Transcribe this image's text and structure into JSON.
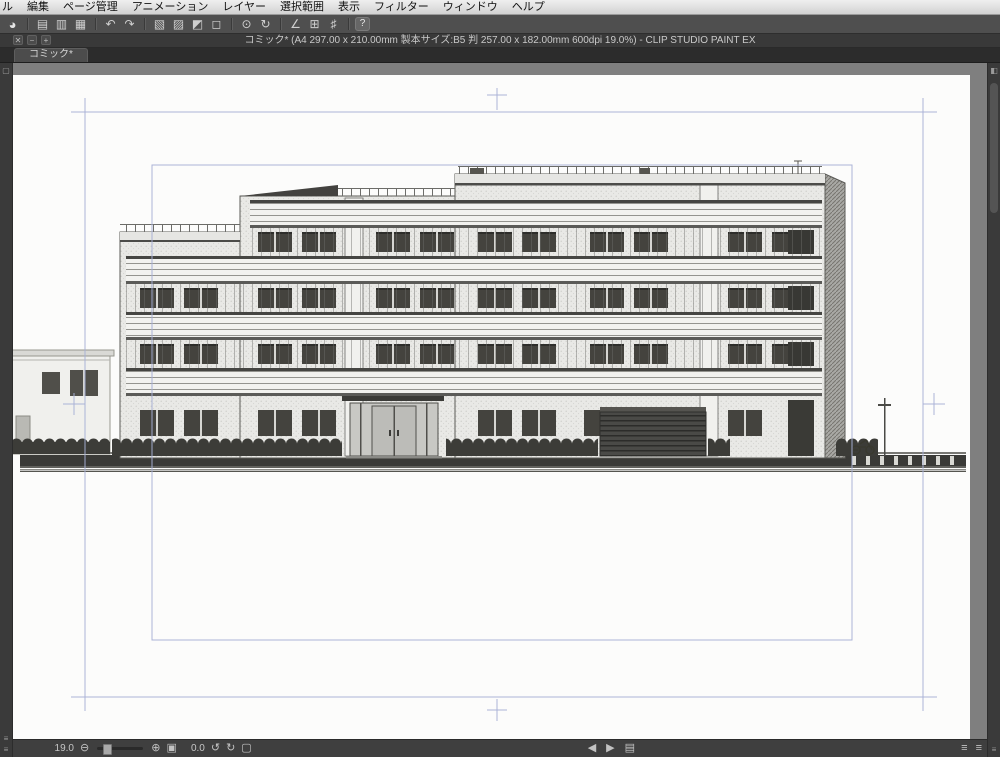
{
  "menubar": {
    "items": [
      "ル",
      "編集",
      "ページ管理",
      "アニメーション",
      "レイヤー",
      "選択範囲",
      "表示",
      "フィルター",
      "ウィンドウ",
      "ヘルプ"
    ]
  },
  "toolbar": {
    "icons": [
      {
        "name": "clip-studio-logo-icon",
        "glyph": "◕"
      },
      {
        "name": "new-canvas-icon",
        "glyph": "▤"
      },
      {
        "name": "open-file-icon",
        "glyph": "▥"
      },
      {
        "name": "save-icon",
        "glyph": "▦"
      },
      {
        "name": "undo-icon",
        "glyph": "↶"
      },
      {
        "name": "redo-icon",
        "glyph": "↷"
      },
      {
        "name": "deselect-icon",
        "glyph": "▧"
      },
      {
        "name": "reselect-icon",
        "glyph": "▨"
      },
      {
        "name": "invert-selection-icon",
        "glyph": "◩"
      },
      {
        "name": "marquee-icon",
        "glyph": "◻"
      },
      {
        "name": "zoom-tool-icon",
        "glyph": "⊙"
      },
      {
        "name": "rotate-canvas-icon",
        "glyph": "↻"
      },
      {
        "name": "snap-ruler-icon",
        "glyph": "∠"
      },
      {
        "name": "snap-grid-icon",
        "glyph": "⊞"
      },
      {
        "name": "snap-guide-icon",
        "glyph": "♯"
      },
      {
        "name": "help-icon",
        "glyph": "?"
      }
    ]
  },
  "titlebar": {
    "title": "コミック* (A4 297.00 x 210.00mm 製本サイズ:B5 判 257.00 x 182.00mm 600dpi 19.0%)  - CLIP STUDIO PAINT EX",
    "buttons": {
      "close": "✕",
      "minimize": "−",
      "maximize": "+"
    }
  },
  "tabs": {
    "active": "コミック*"
  },
  "statusbar": {
    "zoom_value": "19.0",
    "rotation_value": "0.0",
    "icons": {
      "zoom_out": "⊖",
      "zoom_in": "⊕",
      "fit": "▣",
      "rotate_left": "↺",
      "rotate_right": "↻",
      "reset": "▢",
      "prev_page": "◀",
      "next_page": "▶",
      "page_list": "▤",
      "panel_toggle_1": "≡",
      "panel_toggle_2": "≡"
    }
  },
  "edges": {
    "left_top": "▢",
    "left_bottom1": "≡",
    "left_bottom2": "≡",
    "right_top": "◧",
    "right_bottom": "≡"
  },
  "colors": {
    "canvas_bg": "#7f7f7f",
    "guide_blue": "#a7b0d6",
    "chrome_dark": "#4f4f4f",
    "menubar_bg": "#d9d9d9"
  }
}
